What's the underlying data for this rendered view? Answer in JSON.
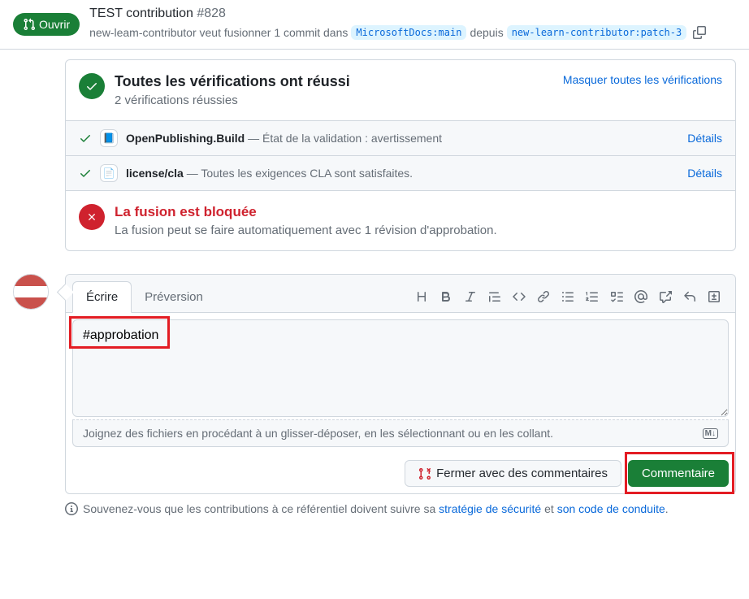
{
  "header": {
    "status": "Ouvrir",
    "title": "TEST contribution",
    "number": "#828",
    "subtitle_prefix": "new-leam-contributor veut fusionner 1 commit dans",
    "base_branch": "MicrosoftDocs:main",
    "subtitle_mid": "depuis",
    "compare_branch": "new-learn-contributor:patch-3"
  },
  "checks": {
    "title": "Toutes les vérifications ont réussi",
    "subtitle": "2 vérifications réussies",
    "hide_link": "Masquer toutes les vérifications",
    "items": [
      {
        "name": "OpenPublishing.Build",
        "desc": " — État de la validation : avertissement",
        "details": "Détails",
        "app": "📘"
      },
      {
        "name": "license/cla",
        "desc": " — Toutes les exigences CLA sont satisfaites.",
        "details": "Détails",
        "app": "📄"
      }
    ]
  },
  "merge": {
    "title": "La fusion est bloquée",
    "desc": "La fusion peut se faire automatiquement avec 1 révision d'approbation."
  },
  "editor": {
    "tab_write": "Écrire",
    "tab_preview": "Préversion",
    "content": "#approbation",
    "file_hint": "Joignez des fichiers en procédant à un glisser-déposer, en les sélectionnant ou en les collant.",
    "close_btn": "Fermer avec des commentaires",
    "comment_btn": "Commentaire"
  },
  "footer": {
    "text_prefix": "Souvenez-vous que les contributions à ce référentiel doivent suivre sa ",
    "link1": "stratégie de sécurité",
    "text_mid": " et ",
    "link2": "son code de conduite",
    "text_suffix": "."
  }
}
